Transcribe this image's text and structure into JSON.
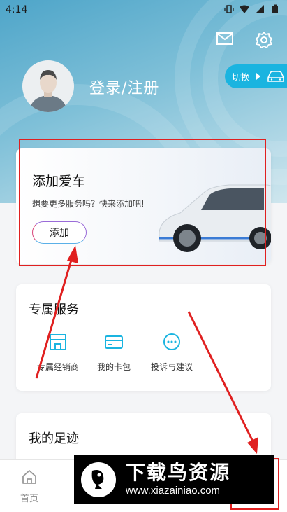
{
  "status_bar": {
    "time": "4:14"
  },
  "header": {
    "login_label": "登录/注册",
    "switch_label": "切换"
  },
  "car_card": {
    "title": "添加爱车",
    "subtitle": "想要更多服务吗？快来添加吧!",
    "add_label": "添加"
  },
  "services": {
    "title": "专属服务",
    "items": [
      {
        "label": "专属经销商",
        "icon": "store-icon"
      },
      {
        "label": "我的卡包",
        "icon": "card-icon"
      },
      {
        "label": "投诉与建议",
        "icon": "chat-icon"
      }
    ]
  },
  "footprint": {
    "title": "我的足迹"
  },
  "bottom_nav": {
    "home_label": "首页"
  },
  "watermark": {
    "main": "下载鸟资源",
    "url": "www.xiazainiao.com"
  },
  "colors": {
    "accent": "#1ab4e0",
    "annotation": "#e02020"
  }
}
